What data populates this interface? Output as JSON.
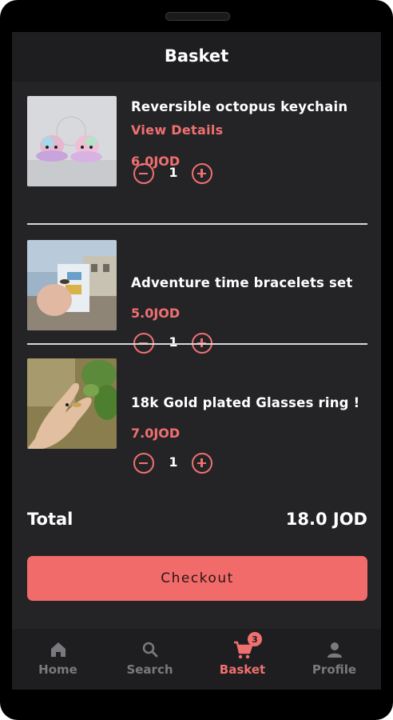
{
  "header": {
    "title": "Basket"
  },
  "items": [
    {
      "name": "Reversible octopus keychain",
      "details_label": "View Details",
      "price": "6.0JOD",
      "qty": "1"
    },
    {
      "name": "Adventure time bracelets set",
      "price": "5.0JOD",
      "qty": "1"
    },
    {
      "name": " 18k Gold plated Glasses ring !",
      "price": "7.0JOD",
      "qty": "1"
    }
  ],
  "summary": {
    "total_label": "Total",
    "total_value": "18.0 JOD"
  },
  "checkout_label": "Checkout",
  "nav": {
    "items": [
      {
        "label": "Home",
        "icon": "home-icon"
      },
      {
        "label": "Search",
        "icon": "search-icon"
      },
      {
        "label": "Basket",
        "icon": "cart-icon",
        "badge": "3",
        "active": true
      },
      {
        "label": "Profile",
        "icon": "profile-icon"
      }
    ]
  },
  "colors": {
    "accent": "#f07070",
    "background": "#242427",
    "bar": "#1e1e20"
  }
}
